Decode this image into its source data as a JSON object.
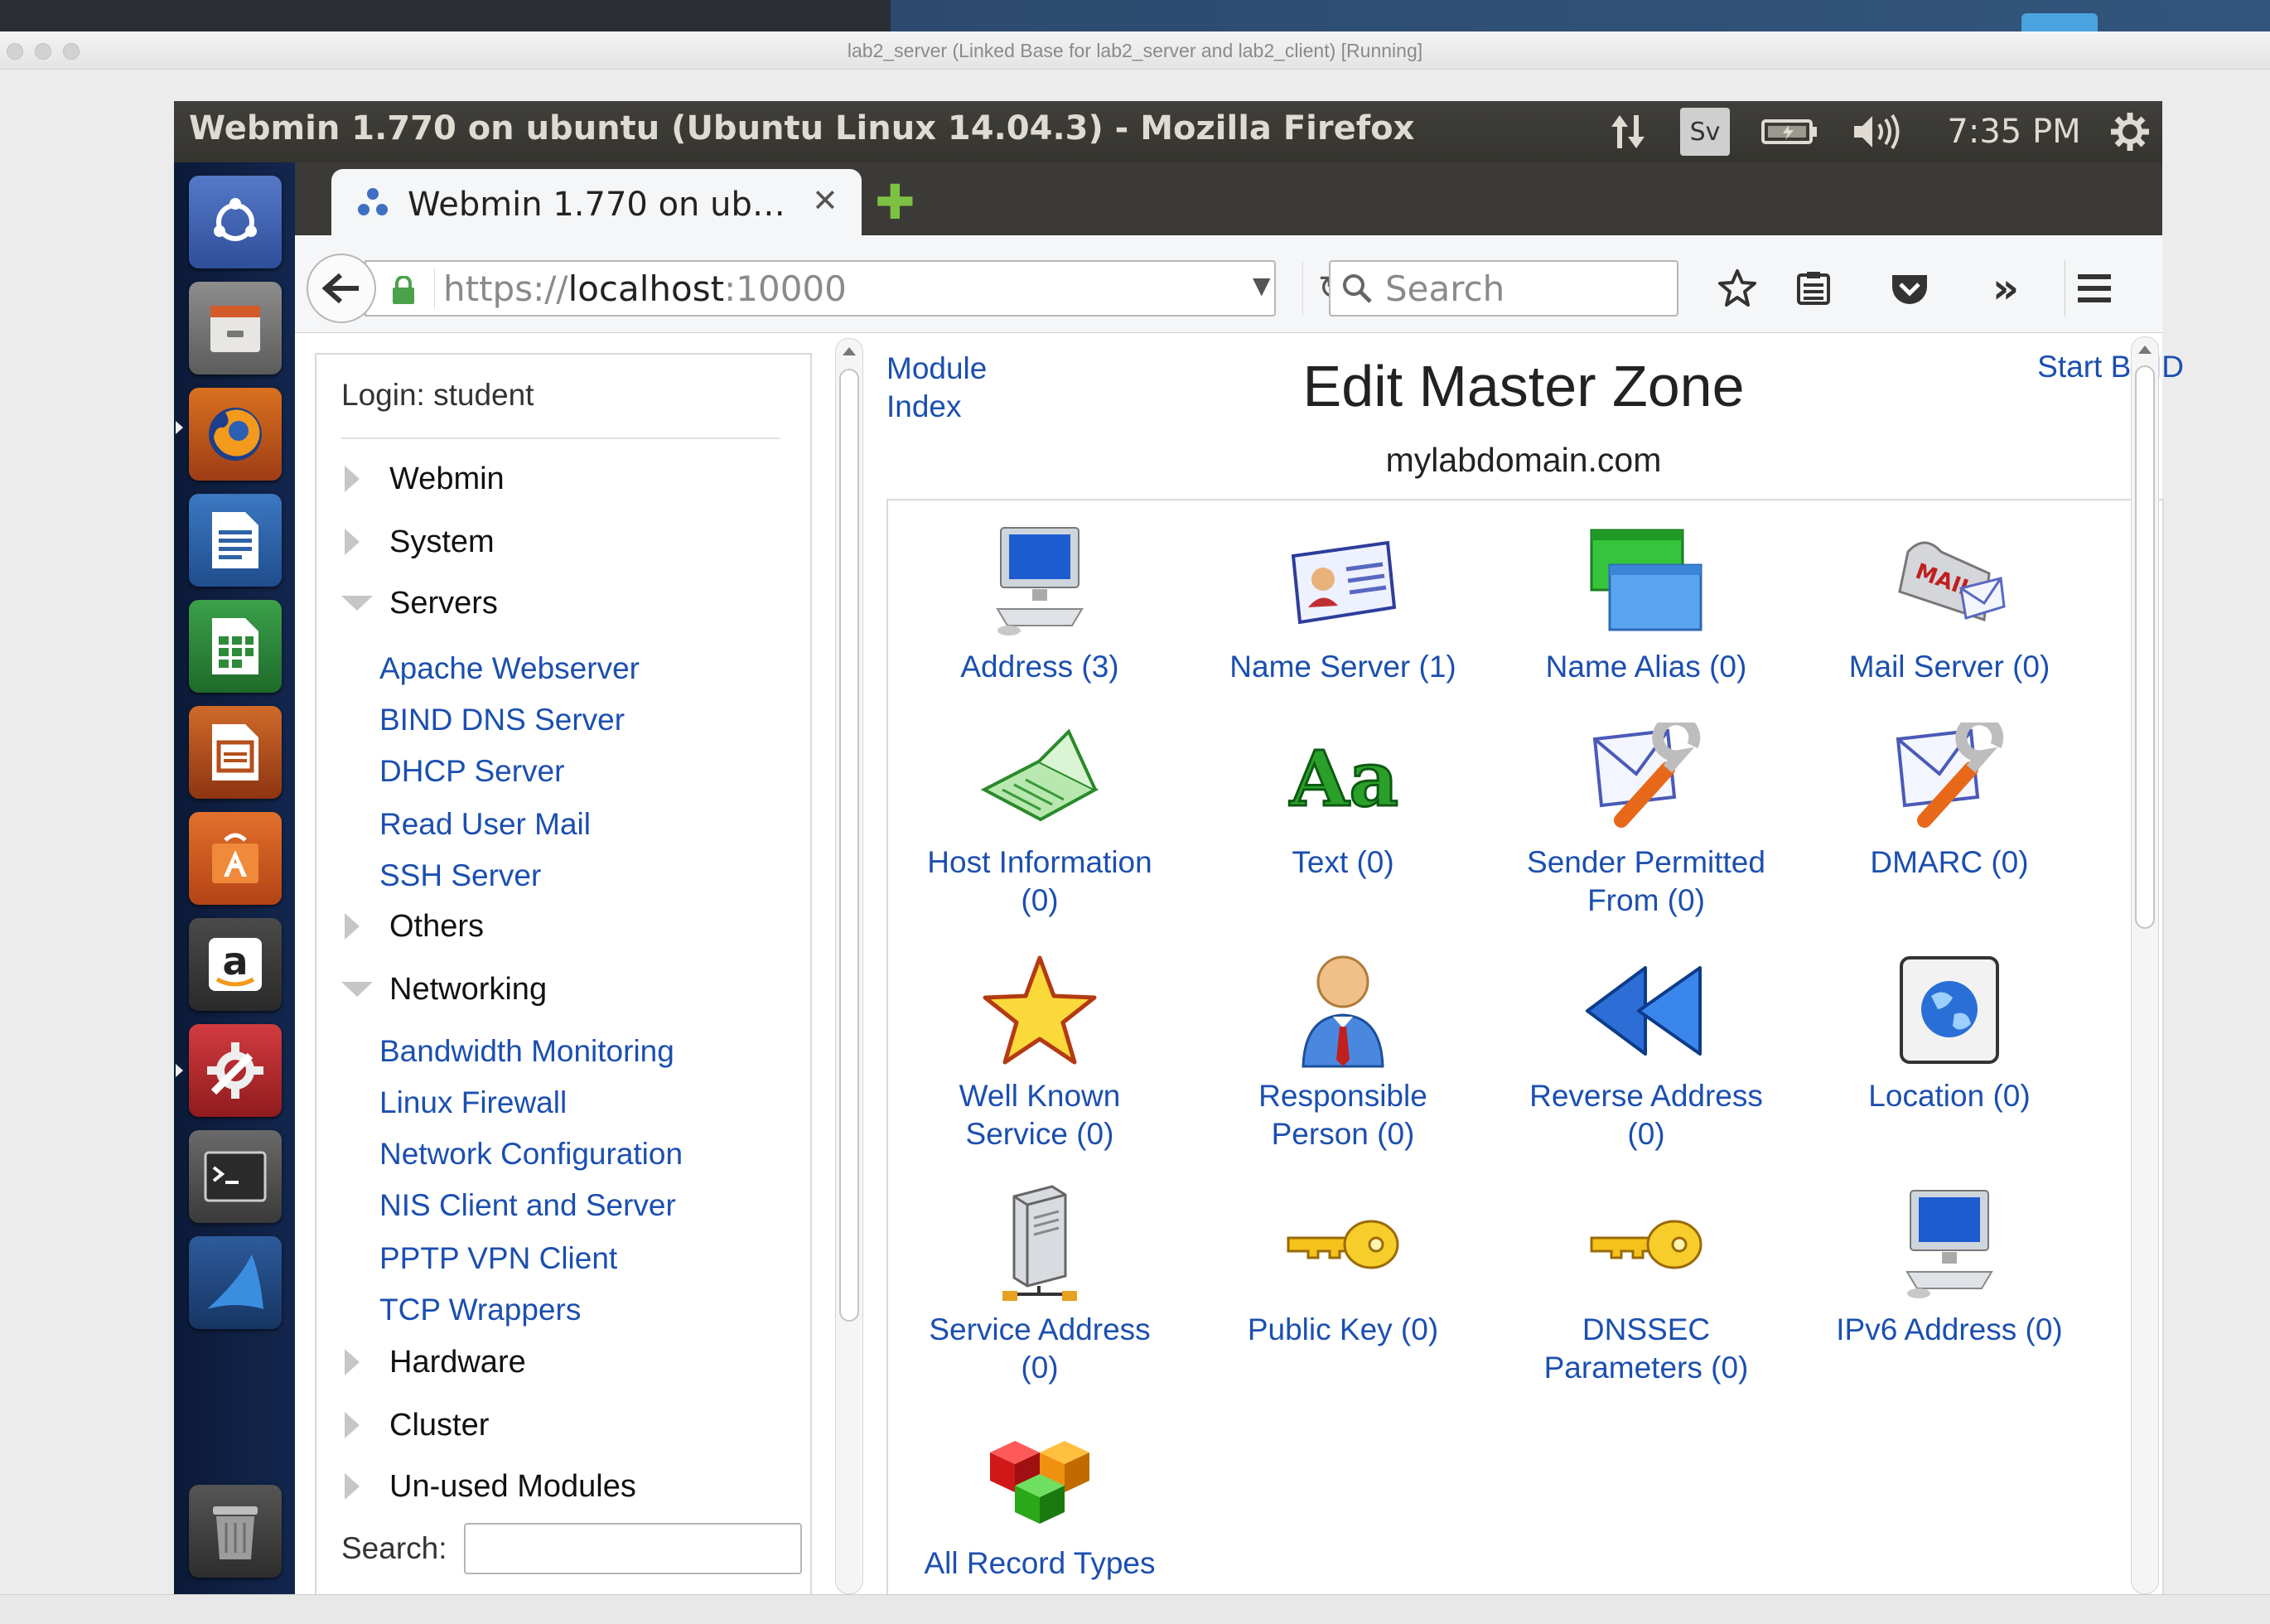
{
  "vm_window": {
    "title": "lab2_server (Linked Base for lab2_server and lab2_client) [Running]"
  },
  "ubuntu_panel": {
    "window_title": "Webmin 1.770 on ubuntu (Ubuntu Linux 14.04.3) - Mozilla Firefox",
    "keyboard_indicator": "Sv",
    "clock": "7:35 PM"
  },
  "launcher": {
    "items": [
      {
        "name": "ubuntu-dash",
        "color": "#3e64b6"
      },
      {
        "name": "files",
        "color": "#7b7b7b"
      },
      {
        "name": "firefox",
        "color": "#c05a1f"
      },
      {
        "name": "writer",
        "color": "#2f62a6"
      },
      {
        "name": "calc",
        "color": "#2e8b3a"
      },
      {
        "name": "impress",
        "color": "#b44f1c"
      },
      {
        "name": "software-center",
        "color": "#d1581f"
      },
      {
        "name": "amazon",
        "color": "#444"
      },
      {
        "name": "system-settings",
        "color": "#b8262a"
      },
      {
        "name": "terminal",
        "color": "#555"
      },
      {
        "name": "wireshark",
        "color": "#1d4f8c"
      },
      {
        "name": "trash",
        "color": "#3a3a3a"
      }
    ]
  },
  "firefox": {
    "tab_title": "Webmin 1.770 on ub…",
    "url_scheme": "https://",
    "url_host": "localhost",
    "url_port": ":10000",
    "search_placeholder": "Search"
  },
  "sidebar": {
    "login": "Login: student",
    "categories": [
      {
        "label": "Webmin",
        "expanded": false
      },
      {
        "label": "System",
        "expanded": false
      },
      {
        "label": "Servers",
        "expanded": true,
        "items": [
          "Apache Webserver",
          "BIND DNS Server",
          "DHCP Server",
          "Read User Mail",
          "SSH Server"
        ]
      },
      {
        "label": "Others",
        "expanded": false
      },
      {
        "label": "Networking",
        "expanded": true,
        "items": [
          "Bandwidth Monitoring",
          "Linux Firewall",
          "Network Configuration",
          "NIS Client and Server",
          "PPTP VPN Client",
          "TCP Wrappers"
        ]
      },
      {
        "label": "Hardware",
        "expanded": false
      },
      {
        "label": "Cluster",
        "expanded": false
      },
      {
        "label": "Un-used Modules",
        "expanded": false
      }
    ],
    "search_label": "Search:"
  },
  "main": {
    "module_index_line1": "Module",
    "module_index_line2": "Index",
    "title": "Edit Master Zone",
    "start_bind": "Start BIND",
    "zone_name": "mylabdomain.com",
    "records": [
      {
        "icon": "computer-icon",
        "line1": "Address (3)",
        "line2": ""
      },
      {
        "icon": "name-card-icon",
        "line1": "Name Server (1)",
        "line2": ""
      },
      {
        "icon": "windows-alias-icon",
        "line1": "Name Alias (0)",
        "line2": ""
      },
      {
        "icon": "mailbox-icon",
        "line1": "Mail Server (0)",
        "line2": ""
      },
      {
        "icon": "laptop-icon",
        "line1": "Host Information",
        "line2": "(0)"
      },
      {
        "icon": "text-aa-icon",
        "line1": "Text (0)",
        "line2": ""
      },
      {
        "icon": "mail-wrench-icon",
        "line1": "Sender Permitted",
        "line2": "From (0)"
      },
      {
        "icon": "mail-wrench-icon",
        "line1": "DMARC (0)",
        "line2": ""
      },
      {
        "icon": "star-icon",
        "line1": "Well Known",
        "line2": "Service (0)"
      },
      {
        "icon": "person-icon",
        "line1": "Responsible",
        "line2": "Person (0)"
      },
      {
        "icon": "rewind-arrow-icon",
        "line1": "Reverse Address",
        "line2": "(0)"
      },
      {
        "icon": "globe-icon",
        "line1": "Location (0)",
        "line2": ""
      },
      {
        "icon": "server-icon",
        "line1": "Service Address",
        "line2": "(0)"
      },
      {
        "icon": "key-icon",
        "line1": "Public Key (0)",
        "line2": ""
      },
      {
        "icon": "key-icon",
        "line1": "DNSSEC",
        "line2": "Parameters (0)"
      },
      {
        "icon": "computer-icon",
        "line1": "IPv6 Address (0)",
        "line2": ""
      },
      {
        "icon": "cubes-icon",
        "line1": "All Record Types",
        "line2": ""
      }
    ]
  }
}
